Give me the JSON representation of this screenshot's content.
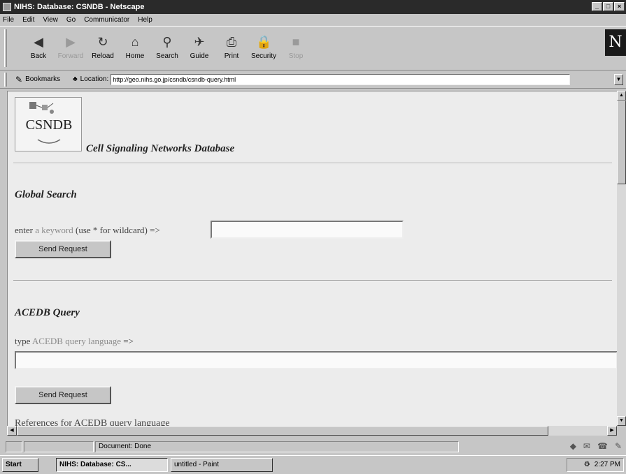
{
  "window": {
    "title": "NIHS: Database: CSNDB - Netscape"
  },
  "menu": [
    "File",
    "Edit",
    "View",
    "Go",
    "Communicator",
    "Help"
  ],
  "toolbar": [
    {
      "label": "Back",
      "icon": "back-arrow-icon",
      "glyph": "◀",
      "enabled": true
    },
    {
      "label": "Forward",
      "icon": "forward-arrow-icon",
      "glyph": "▶",
      "enabled": false
    },
    {
      "label": "Reload",
      "icon": "reload-icon",
      "glyph": "↻",
      "enabled": true
    },
    {
      "label": "Home",
      "icon": "home-icon",
      "glyph": "⌂",
      "enabled": true
    },
    {
      "label": "Search",
      "icon": "search-icon",
      "glyph": "⚲",
      "enabled": true
    },
    {
      "label": "Guide",
      "icon": "guide-icon",
      "glyph": "✈",
      "enabled": true
    },
    {
      "label": "Print",
      "icon": "print-icon",
      "glyph": "⎙",
      "enabled": true
    },
    {
      "label": "Security",
      "icon": "security-lock-icon",
      "glyph": "🔒",
      "enabled": true
    },
    {
      "label": "Stop",
      "icon": "stop-icon",
      "glyph": "■",
      "enabled": false
    }
  ],
  "location": {
    "bookmarks_label": "Bookmarks",
    "location_label": "Location:",
    "url": "http://geo.nihs.go.jp/csndb/csndb-query.html"
  },
  "page": {
    "logo_text": "CSNDB",
    "site_title": "Cell Signaling Networks Database",
    "global_search": {
      "heading": "Global Search",
      "prefix": "enter ",
      "link": "a keyword",
      "suffix": " (use * for wildcard) =>",
      "input_value": "",
      "button": "Send Request"
    },
    "acedb_query": {
      "heading": "ACEDB Query",
      "prefix": "type ",
      "link": "ACEDB query language",
      "suffix": " =>",
      "input_value": "",
      "button": "Send Request"
    },
    "references_text": "References for ACEDB query language"
  },
  "status": {
    "text": "Document: Done"
  },
  "taskbar": {
    "start": "Start",
    "tasks": [
      {
        "label": "NIHS: Database: CS...",
        "active": true
      },
      {
        "label": "untitled - Paint",
        "active": false
      }
    ],
    "clock": "2:27 PM"
  }
}
